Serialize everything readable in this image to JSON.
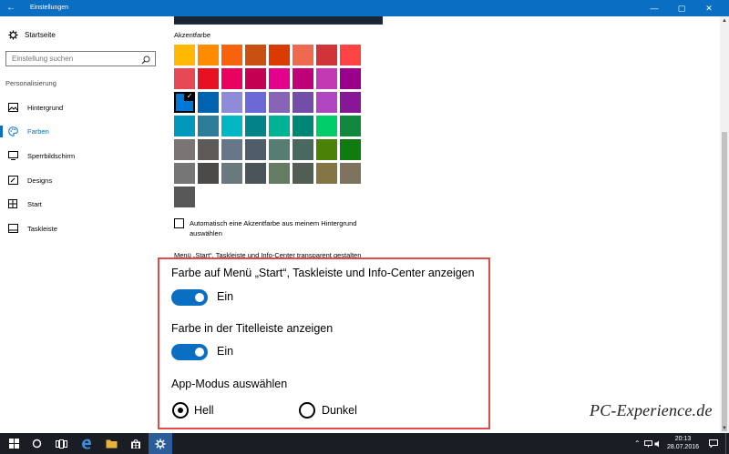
{
  "window": {
    "title": "Einstellungen",
    "back_glyph": "←",
    "minimize_glyph": "—",
    "maximize_glyph": "▢",
    "close_glyph": "✕"
  },
  "sidebar": {
    "home_label": "Startseite",
    "search_placeholder": "Einstellung suchen",
    "section_heading": "Personalisierung",
    "items": [
      {
        "label": "Hintergrund",
        "icon": "image-icon",
        "active": false
      },
      {
        "label": "Farben",
        "icon": "palette-icon",
        "active": true
      },
      {
        "label": "Sperrbildschirm",
        "icon": "lock-screen-icon",
        "active": false
      },
      {
        "label": "Designs",
        "icon": "brush-icon",
        "active": false
      },
      {
        "label": "Start",
        "icon": "start-icon",
        "active": false
      },
      {
        "label": "Taskleiste",
        "icon": "taskbar-icon",
        "active": false
      }
    ]
  },
  "content": {
    "accent_heading": "Akzentfarbe",
    "swatches": [
      [
        "#ffb900",
        "#ff8c00",
        "#f7630c",
        "#ca5010",
        "#da3b01",
        "#ef6950",
        "#d13438",
        "#ff4343"
      ],
      [
        "#e74856",
        "#e81123",
        "#ea005e",
        "#c30052",
        "#e3008c",
        "#bf0077",
        "#c239b3",
        "#9a0089"
      ],
      [
        "#0078d7",
        "#0063b1",
        "#8e8cd8",
        "#6b69d6",
        "#8764b8",
        "#744da9",
        "#b146c2",
        "#881798"
      ],
      [
        "#0099bc",
        "#2d7d9a",
        "#00b7c3",
        "#038387",
        "#00b294",
        "#018574",
        "#00cc6a",
        "#10893e"
      ],
      [
        "#7a7574",
        "#5d5a58",
        "#68768a",
        "#515c6b",
        "#567c73",
        "#486860",
        "#498205",
        "#107c10"
      ],
      [
        "#767676",
        "#4c4a48",
        "#69797e",
        "#4a5459",
        "#647c64",
        "#525e54",
        "#847545",
        "#7e735f"
      ],
      [
        "#575757"
      ]
    ],
    "selected_swatch": "#0078d7",
    "auto_accent_label": "Automatisch eine Akzentfarbe aus meinem Hintergrund auswählen",
    "transparency_label": "Menü „Start“, Taskleiste und Info-Center transparent gestalten",
    "show_color_start_label": "Farbe auf Menü „Start“, Taskleiste und Info-Center anzeigen",
    "show_color_start_state": "Ein",
    "show_color_titlebar_label": "Farbe in der Titelleiste anzeigen",
    "show_color_titlebar_state": "Ein",
    "app_mode_heading": "App-Modus auswählen",
    "app_mode_options": [
      "Hell",
      "Dunkel"
    ],
    "app_mode_selected": "Hell"
  },
  "watermark": "PC-Experience.de",
  "taskbar": {
    "time": "20:13",
    "date": "28.07.2016",
    "apps": [
      "start-icon",
      "cortana-icon",
      "task-view-icon",
      "edge-icon",
      "explorer-icon",
      "store-icon",
      "settings-icon"
    ]
  },
  "colors": {
    "accent": "#0a6fc2",
    "highlight_border": "#e04b4b",
    "taskbar": "#1a1e24"
  }
}
